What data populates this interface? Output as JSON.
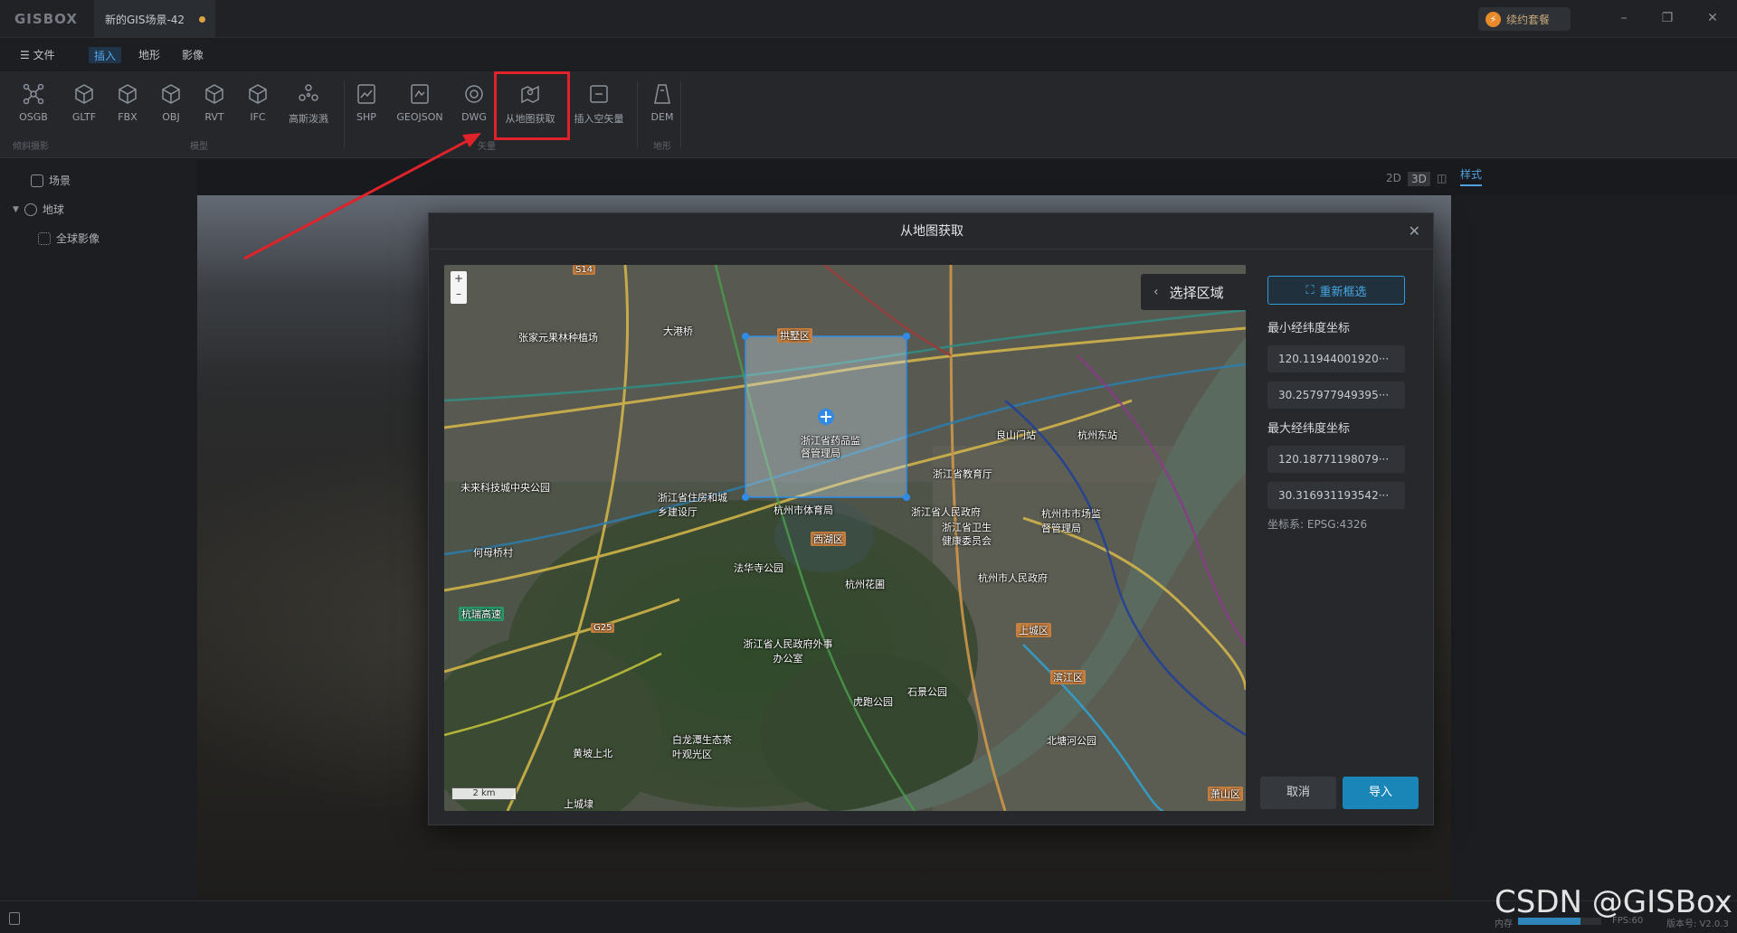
{
  "titlebar": {
    "logo": "GISBOX",
    "doc_tab": "新的GIS场景-42",
    "renew": "续约套餐"
  },
  "menu": {
    "file": "文件",
    "tabs": [
      "插入",
      "地形",
      "影像"
    ]
  },
  "ribbon": {
    "buttons": [
      "OSGB",
      "GLTF",
      "FBX",
      "OBJ",
      "RVT",
      "IFC",
      "高斯泼溅",
      "SHP",
      "GEOJSON",
      "DWG",
      "从地图获取",
      "插入空矢量",
      "DEM"
    ],
    "groups": [
      "倾斜摄影",
      "模型",
      "矢量",
      "地形"
    ]
  },
  "tree": {
    "scene": "场景",
    "earth": "地球",
    "global_imagery": "全球影像"
  },
  "view": {
    "modes": [
      "2D",
      "3D"
    ],
    "style_tab": "样式"
  },
  "dialog": {
    "title": "从地图获取",
    "select_area": "选择区域",
    "reselect": "重新框选",
    "min_label": "最小经纬度坐标",
    "min_lon": "120.11944001920···",
    "min_lat": "30.257977949395···",
    "max_label": "最大经纬度坐标",
    "max_lon": "120.18771198079···",
    "max_lat": "30.316931193542···",
    "crs": "坐标系: EPSG:4326",
    "cancel": "取消",
    "import": "导入",
    "scale": "2 km"
  },
  "map_labels": [
    "大港桥",
    "拱墅区",
    "浙江省药品监督管理局",
    "浙江省教育厅",
    "浙江省住房和城乡建设厅",
    "杭州市体育局",
    "浙江省人民政府",
    "浙江省卫生健康委员会",
    "杭州市市场监督管理局",
    "西湖区",
    "杭州市人民政府",
    "上城区",
    "滨江区",
    "浙江省人民政府外事办公室",
    "何母桥村",
    "法华寺公园",
    "杭州花圃",
    "虎跑公园",
    "石景公园",
    "黄坡上北",
    "上城埭",
    "北塘河公园",
    "良山门站",
    "杭州东站",
    "未来科技城中央公园",
    "张家元果林种植场",
    "杭瑞高速",
    "萧山区",
    "G25",
    "S14",
    "白龙潭生态茶叶观光区"
  ],
  "status": {
    "memory_label": "内存",
    "memory_fraction": 0.75,
    "fps": "FPS:60",
    "version": "版本号: V2.0.3"
  },
  "watermark": "CSDN @GISBox",
  "colors": {
    "accent": "#1a86b8",
    "highlight": "#e0232b",
    "selection": "#2f8be6"
  }
}
